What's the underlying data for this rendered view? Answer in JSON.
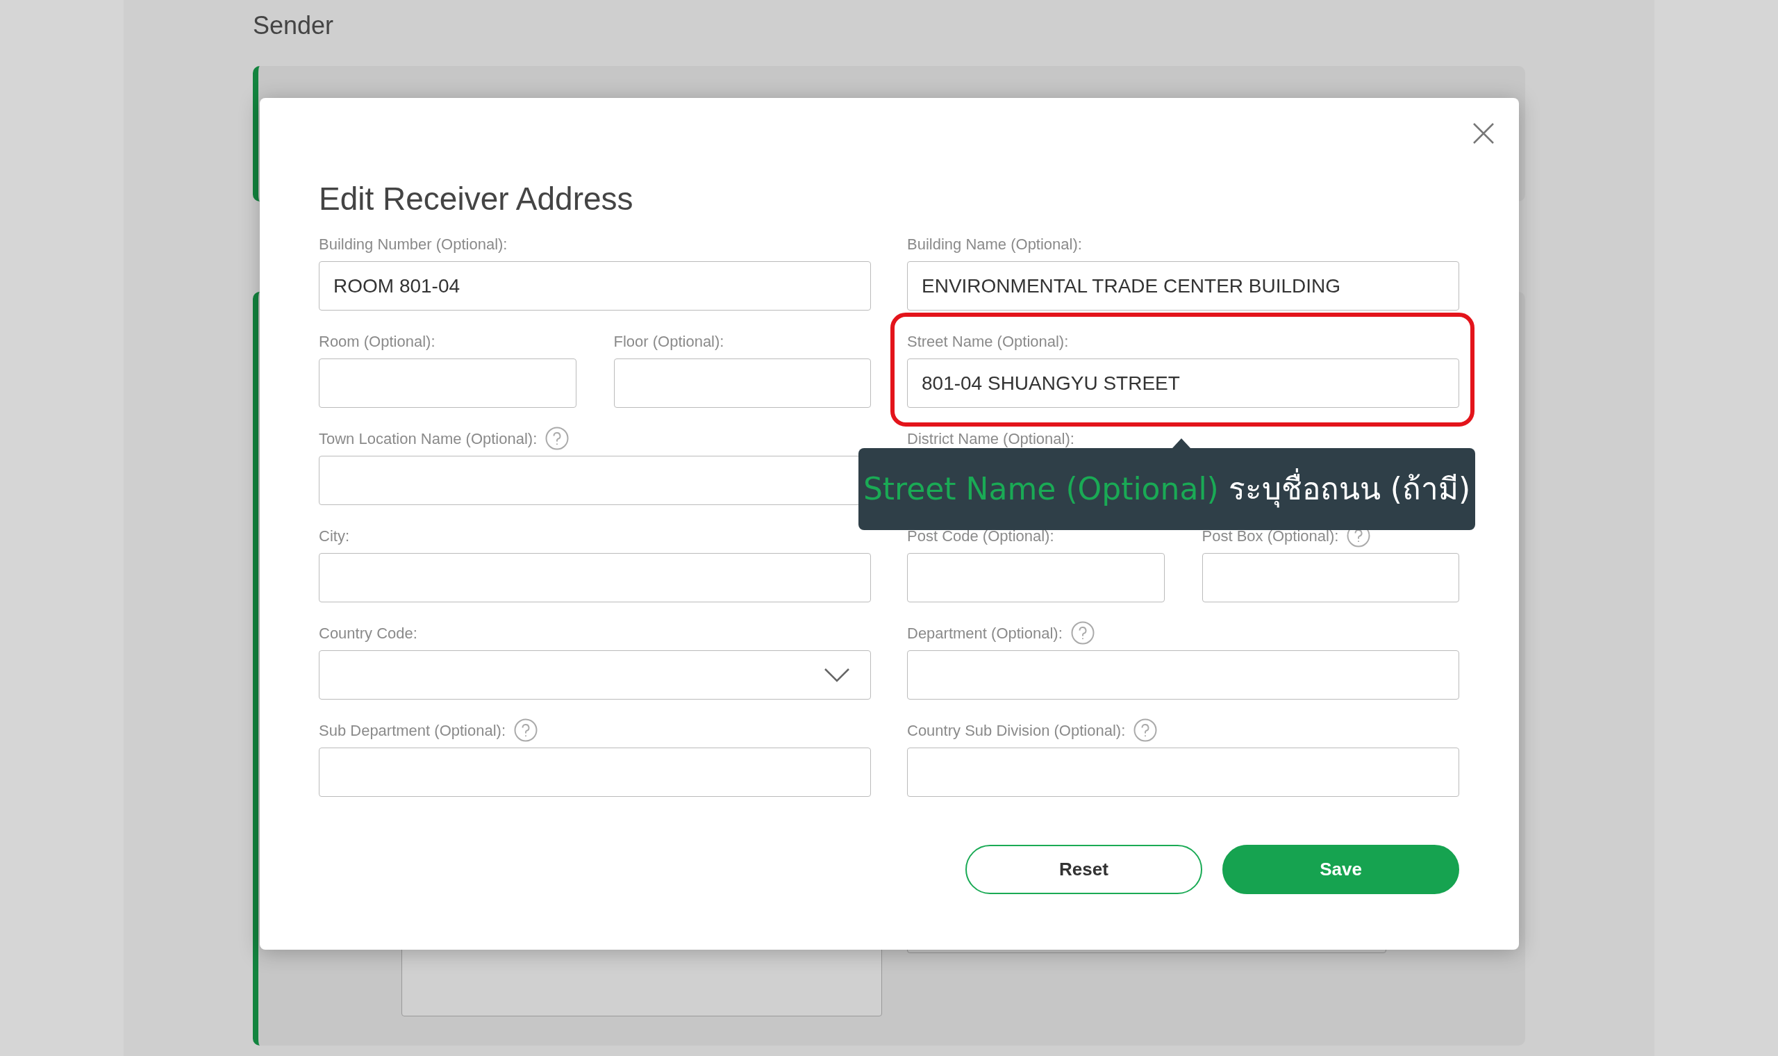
{
  "background": {
    "heading": "Sender"
  },
  "modal": {
    "title": "Edit Receiver Address",
    "rows": [
      {
        "left": [
          {
            "kind": "text",
            "label": "Building Number (Optional):",
            "value": "ROOM 801-04",
            "help": false
          }
        ],
        "right": [
          {
            "kind": "text",
            "label": "Building Name (Optional):",
            "value": "ENVIRONMENTAL TRADE CENTER BUILDING",
            "help": false
          }
        ]
      },
      {
        "left": [
          {
            "kind": "text",
            "label": "Room (Optional):",
            "help": false
          },
          {
            "kind": "text",
            "label": "Floor (Optional):",
            "help": false
          }
        ],
        "right": [
          {
            "kind": "text",
            "label": "Street Name (Optional):",
            "value": "801-04 SHUANGYU STREET",
            "help": false,
            "highlighted": true
          }
        ]
      },
      {
        "left": [
          {
            "kind": "text",
            "label": "Town Location Name (Optional):",
            "help": true
          }
        ],
        "right": [
          {
            "kind": "label_only",
            "label": "District Name (Optional):",
            "help": false
          }
        ]
      },
      {
        "left": [
          {
            "kind": "text",
            "label": "City:",
            "help": false
          }
        ],
        "right": [
          {
            "kind": "text",
            "label": "Post Code (Optional):",
            "help": false
          },
          {
            "kind": "text",
            "label": "Post Box (Optional):",
            "help": true
          }
        ]
      },
      {
        "left": [
          {
            "kind": "select",
            "label": "Country Code:",
            "help": false
          }
        ],
        "right": [
          {
            "kind": "text",
            "label": "Department (Optional):",
            "help": true
          }
        ]
      },
      {
        "left": [
          {
            "kind": "text",
            "label": "Sub Department (Optional):",
            "help": true
          }
        ],
        "right": [
          {
            "kind": "text",
            "label": "Country Sub Division (Optional):",
            "help": true
          }
        ]
      }
    ],
    "buttons": [
      {
        "kind": "outline",
        "label": "Reset"
      },
      {
        "kind": "filled",
        "label": "Save"
      }
    ],
    "tooltip": {
      "term": "Street Name (Optional)",
      "text": "ระบุชื่อถนน (ถ้ามี)"
    }
  }
}
